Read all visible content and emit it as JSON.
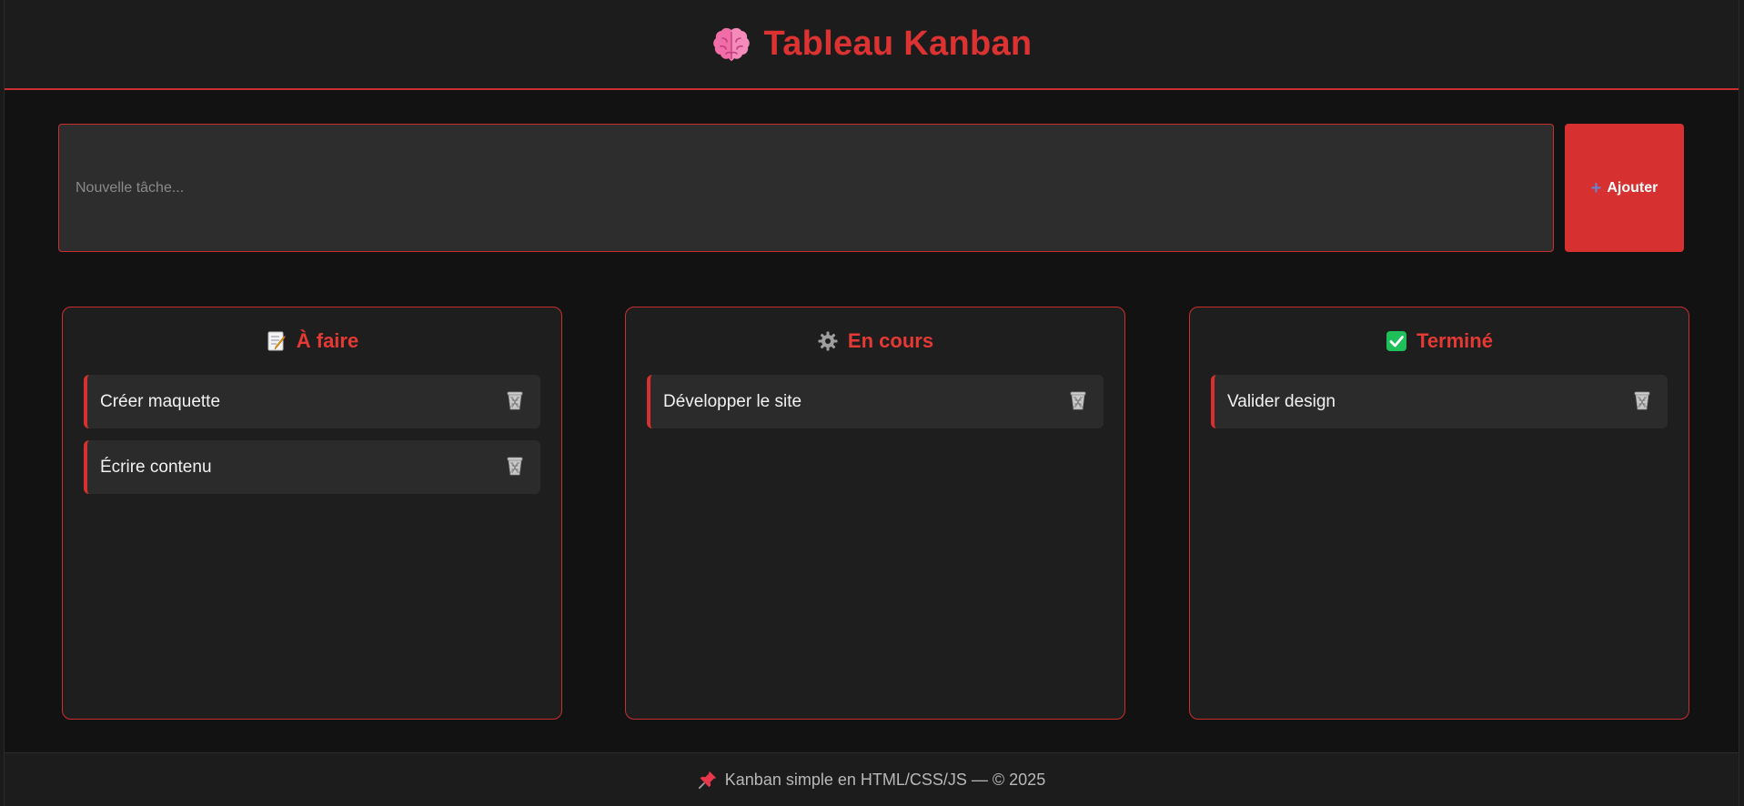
{
  "header": {
    "title": "Tableau Kanban",
    "icon": "brain-icon"
  },
  "add_form": {
    "placeholder": "Nouvelle tâche...",
    "value": "",
    "button_label": "Ajouter",
    "button_icon": "plus-icon"
  },
  "columns": [
    {
      "title": "À faire",
      "icon": "memo-icon",
      "tasks": [
        {
          "text": "Créer maquette"
        },
        {
          "text": "Écrire contenu"
        }
      ]
    },
    {
      "title": "En cours",
      "icon": "gear-icon",
      "tasks": [
        {
          "text": "Développer le site"
        }
      ]
    },
    {
      "title": "Terminé",
      "icon": "check-box-icon",
      "tasks": [
        {
          "text": "Valider design"
        }
      ]
    }
  ],
  "footer": {
    "text": "Kanban simple en HTML/CSS/JS — © 2025",
    "icon": "pin-icon"
  },
  "colors": {
    "accent": "#d63030",
    "background": "#121212",
    "column_bg": "#1e1e1e",
    "task_bg": "#2b2b2b"
  }
}
